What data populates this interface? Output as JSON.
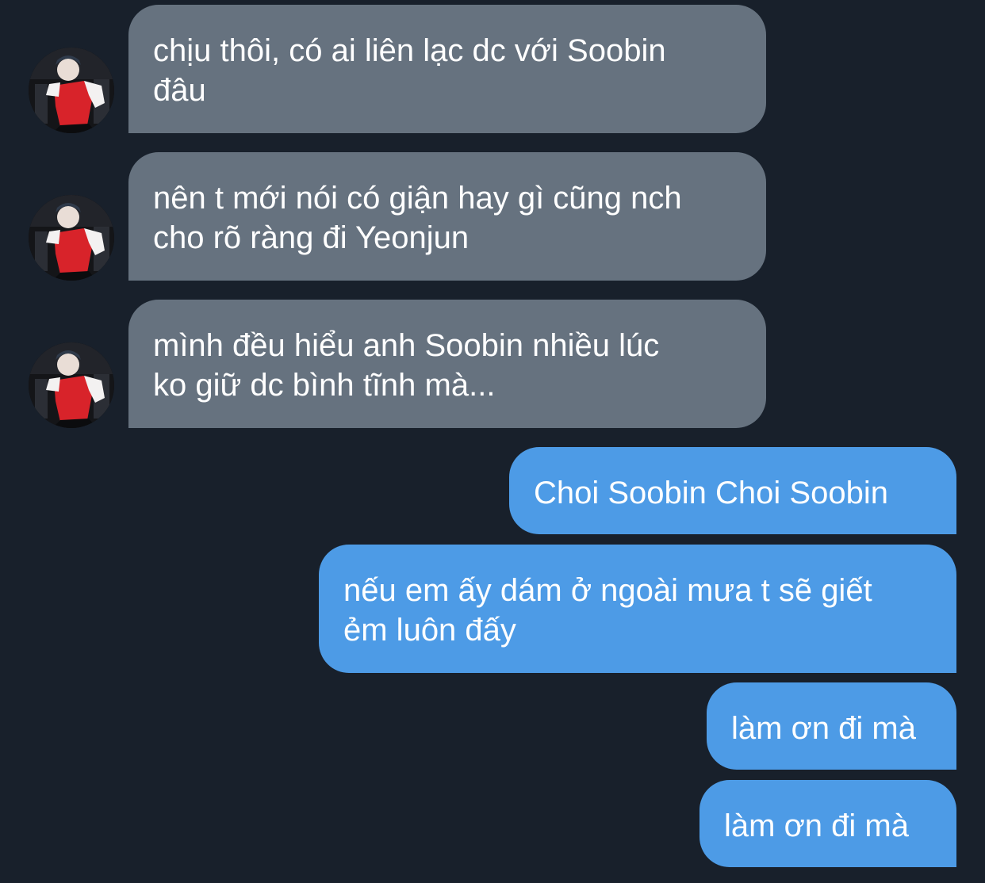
{
  "conversation": {
    "incoming": [
      {
        "lines": [
          "chịu thôi, có ai liên lạc dc với Soobin",
          "đâu"
        ]
      },
      {
        "lines": [
          "nên t mới nói có giận hay gì cũng nch",
          "cho rõ ràng đi Yeonjun"
        ]
      },
      {
        "lines": [
          "mình đều hiểu anh Soobin nhiều lúc",
          "ko giữ dc bình tĩnh mà..."
        ]
      }
    ],
    "outgoing": [
      {
        "lines": [
          "Choi Soobin Choi Soobin"
        ]
      },
      {
        "lines": [
          "nếu em ấy dám ở ngoài mưa t sẽ giết",
          "ẻm luôn đấy"
        ]
      },
      {
        "lines": [
          "làm ơn đi mà"
        ]
      },
      {
        "lines": [
          "làm ơn đi mà"
        ]
      }
    ]
  },
  "colors": {
    "background": "#18202b",
    "incoming_bubble": "#66727f",
    "outgoing_bubble": "#4d9be6",
    "text": "#ffffff"
  },
  "icons": {
    "avatar": "contact-avatar-photo"
  }
}
